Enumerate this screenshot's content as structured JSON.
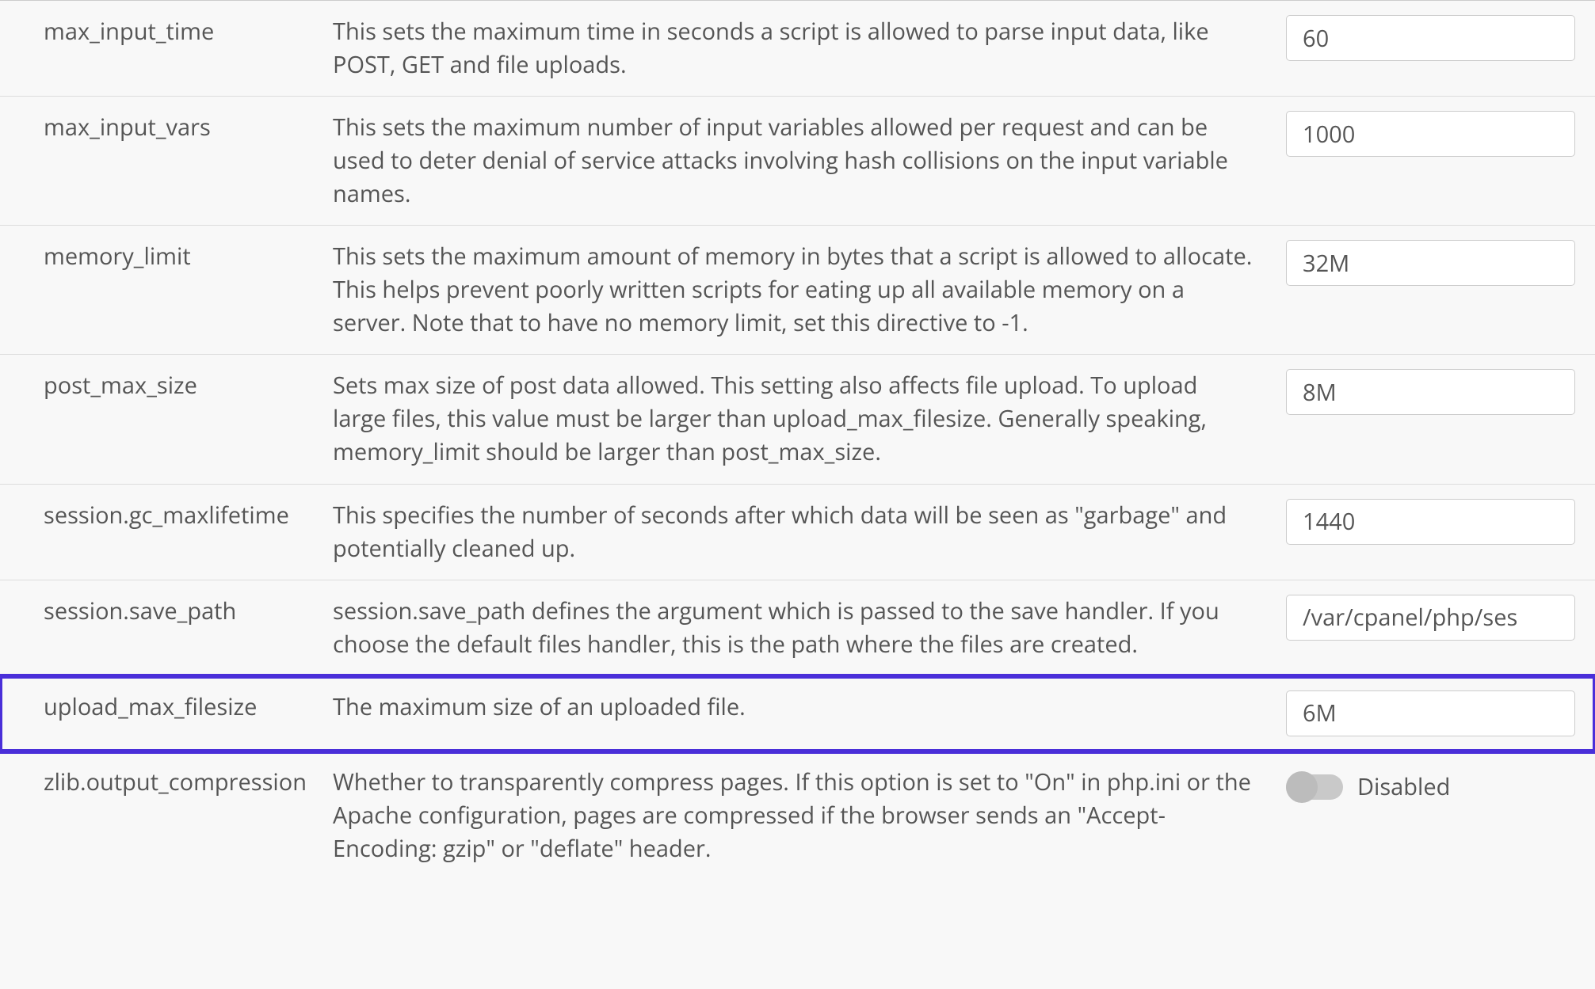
{
  "settings": [
    {
      "name": "max_input_time",
      "desc": "This sets the maximum time in seconds a script is allowed to parse input data, like POST, GET and file uploads.",
      "value": "60",
      "control": "text",
      "highlight": false
    },
    {
      "name": "max_input_vars",
      "desc": "This sets the maximum number of input variables allowed per request and can be used to deter denial of service attacks involving hash collisions on the input variable names.",
      "value": "1000",
      "control": "text",
      "highlight": false
    },
    {
      "name": "memory_limit",
      "desc": "This sets the maximum amount of memory in bytes that a script is allowed to allocate. This helps prevent poorly written scripts for eating up all available memory on a server. Note that to have no memory limit, set this directive to -1.",
      "value": "32M",
      "control": "text",
      "highlight": false
    },
    {
      "name": "post_max_size",
      "desc": "Sets max size of post data allowed. This setting also affects file upload. To upload large files, this value must be larger than upload_max_filesize. Generally speaking, memory_limit should be larger than post_max_size.",
      "value": "8M",
      "control": "text",
      "highlight": false
    },
    {
      "name": "session.gc_maxlifetime",
      "desc": "This specifies the number of seconds after which data will be seen as \"garbage\" and potentially cleaned up.",
      "value": "1440",
      "control": "text",
      "highlight": false
    },
    {
      "name": "session.save_path",
      "desc": "session.save_path defines the argument which is passed to the save handler. If you choose the default files handler, this is the path where the files are created.",
      "value": "/var/cpanel/php/ses",
      "control": "text",
      "highlight": false
    },
    {
      "name": "upload_max_filesize",
      "desc": "The maximum size of an uploaded file.",
      "value": "6M",
      "control": "text",
      "highlight": true
    },
    {
      "name": "zlib.output_compression",
      "desc": "Whether to transparently compress pages. If this option is set to \"On\" in php.ini or the Apache configuration, pages are compressed if the browser sends an \"Accept-Encoding: gzip\" or \"deflate\" header.",
      "value": "Disabled",
      "control": "toggle",
      "toggle_on": false,
      "highlight": false
    }
  ]
}
